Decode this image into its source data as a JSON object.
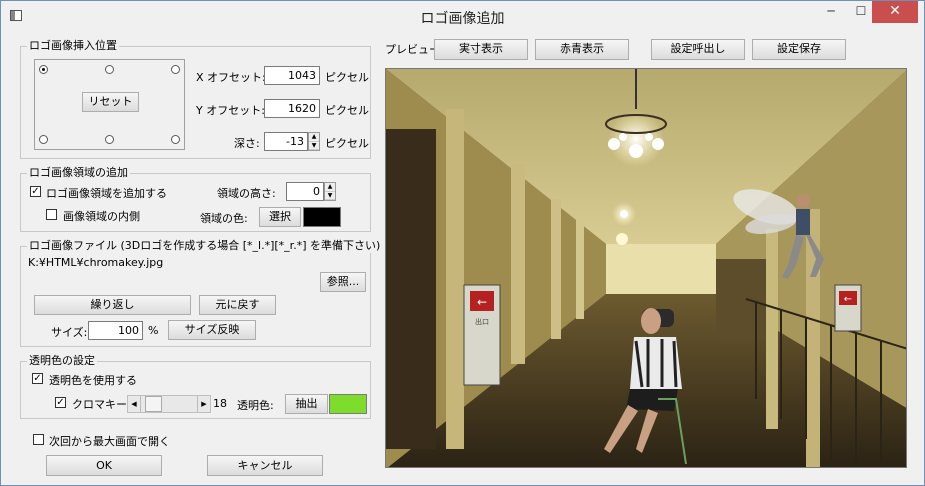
{
  "window": {
    "title": "ロゴ画像追加",
    "minimize": "─",
    "maximize": "☐",
    "close": "✕"
  },
  "position_group": {
    "label": "ロゴ画像挿入位置",
    "reset_label": "リセット",
    "x_offset_label": "X オフセット:",
    "x_offset_value": "1043",
    "y_offset_label": "Y オフセット:",
    "y_offset_value": "1620",
    "depth_label": "深さ:",
    "depth_value": "-13",
    "unit": "ピクセル",
    "selected_anchor": "top-left"
  },
  "region_group": {
    "label": "ロゴ画像領域の追加",
    "add_region_label": "ロゴ画像領域を追加する",
    "add_region_checked": true,
    "inside_label": "画像領域の内側",
    "inside_checked": false,
    "height_label": "領域の高さ:",
    "height_value": "0",
    "color_label": "領域の色:",
    "select_label": "選択",
    "region_color": "#000000"
  },
  "file_group": {
    "label": "ロゴ画像ファイル (3Dロゴを作成する場合 [*_l.*][*_r.*] を準備下さい)",
    "path": "K:¥HTML¥chromakey.jpg",
    "browse_label": "参照...",
    "repeat_label": "繰り返し",
    "restore_label": "元に戻す",
    "size_label": "サイズ:",
    "size_value": "100",
    "size_unit": "%",
    "apply_size_label": "サイズ反映"
  },
  "transparent_group": {
    "label": "透明色の設定",
    "use_label": "透明色を使用する",
    "use_checked": true,
    "chroma_label": "クロマキー",
    "chroma_checked": true,
    "slider_value": "18",
    "slider_fraction": 0.1,
    "tcolor_label": "透明色:",
    "extract_label": "抽出",
    "transparent_color": "#7ddc2c"
  },
  "next_max_label": "次回から最大画面で開く",
  "ok_label": "OK",
  "cancel_label": "キャンセル",
  "preview_toolbar": {
    "label": "プレビュー",
    "actual_label": "実寸表示",
    "anaglyph_label": "赤青表示",
    "load_label": "設定呼出し",
    "save_label": "設定保存"
  },
  "preview_signs": {
    "arrow": "←",
    "sign_text": "出口"
  },
  "icons": {
    "minimize": "minimize-icon",
    "maximize": "maximize-icon",
    "close": "close-icon",
    "spin_up": "▲",
    "spin_down": "▼",
    "left": "◀",
    "right": "▶"
  }
}
